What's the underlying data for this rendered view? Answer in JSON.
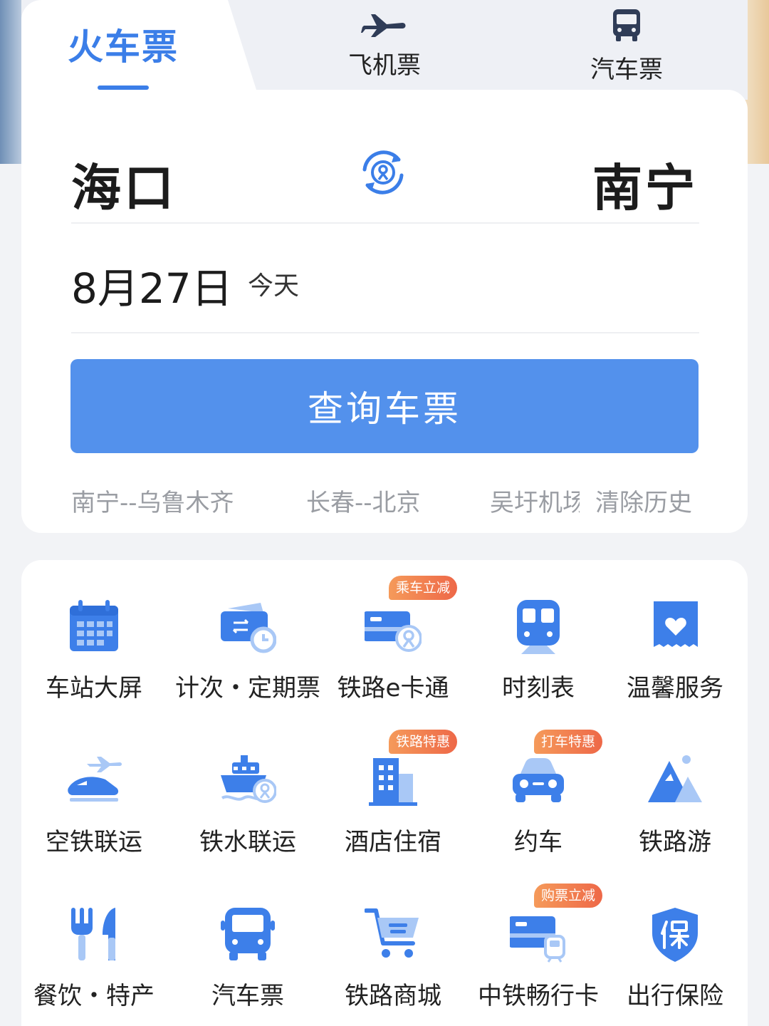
{
  "tabs": {
    "train": "火车票",
    "flight": "飞机票",
    "bus": "汽车票"
  },
  "route": {
    "from": "海口",
    "to": "南宁"
  },
  "date": {
    "value": "8月27日",
    "label": "今天"
  },
  "search_label": "查询车票",
  "history": {
    "items": [
      "南宁--乌鲁木齐",
      "长春--北京",
      "吴圩机场"
    ],
    "clear": "清除历史"
  },
  "services": [
    {
      "label": "车站大屏",
      "icon": "calendar-icon"
    },
    {
      "label": "计次・定期票",
      "icon": "ticket-clock-icon"
    },
    {
      "label": "铁路e卡通",
      "icon": "rail-card-icon",
      "badge": "乘车立减"
    },
    {
      "label": "时刻表",
      "icon": "train-front-icon"
    },
    {
      "label": "温馨服务",
      "icon": "heart-icon"
    },
    {
      "label": "空铁联运",
      "icon": "plane-train-icon"
    },
    {
      "label": "铁水联运",
      "icon": "ship-icon"
    },
    {
      "label": "酒店住宿",
      "icon": "hotel-icon",
      "badge": "铁路特惠"
    },
    {
      "label": "约车",
      "icon": "car-icon",
      "badge": "打车特惠"
    },
    {
      "label": "铁路游",
      "icon": "mountain-icon"
    },
    {
      "label": "餐饮・特产",
      "icon": "fork-knife-icon"
    },
    {
      "label": "汽车票",
      "icon": "bus-icon"
    },
    {
      "label": "铁路商城",
      "icon": "cart-icon"
    },
    {
      "label": "中铁畅行卡",
      "icon": "member-card-icon",
      "badge": "购票立减"
    },
    {
      "label": "出行保险",
      "icon": "shield-icon"
    }
  ],
  "colors": {
    "accent": "#3b7ee8",
    "button": "#5391ec",
    "badge": "#f07a50",
    "icon_dark": "#3d7fe9",
    "icon_light": "#a9c8f6"
  }
}
